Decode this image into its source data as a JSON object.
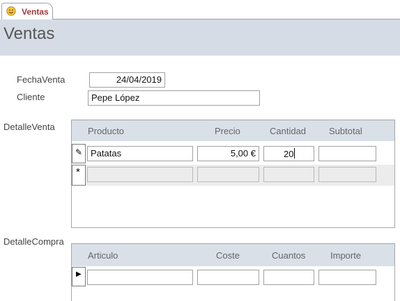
{
  "tab": {
    "label": "Ventas",
    "icon": "smiley-form-icon"
  },
  "form": {
    "title": "Ventas",
    "fecha_label": "FechaVenta",
    "fecha_value": "24/04/2019",
    "cliente_label": "Cliente",
    "cliente_value": "Pepe López"
  },
  "detalle_venta": {
    "label": "DetalleVenta",
    "columns": [
      "Producto",
      "Precio",
      "Cantidad",
      "Subtotal"
    ],
    "rows": [
      {
        "producto": "Patatas",
        "precio": "5,00 €",
        "cantidad": "20",
        "subtotal": ""
      }
    ],
    "edit_marker": "✎",
    "new_marker": "*"
  },
  "detalle_compra": {
    "label": "DetalleCompra",
    "columns": [
      "Articulo",
      "Coste",
      "Cuantos",
      "Importe"
    ],
    "rows": [
      {
        "articulo": "",
        "coste": "",
        "cuantos": "",
        "importe": ""
      }
    ],
    "current_marker": "▶"
  },
  "colors": {
    "header_band": "#d5dce5",
    "tab_text": "#a4373a",
    "subform_header": "#d9e0e8"
  }
}
